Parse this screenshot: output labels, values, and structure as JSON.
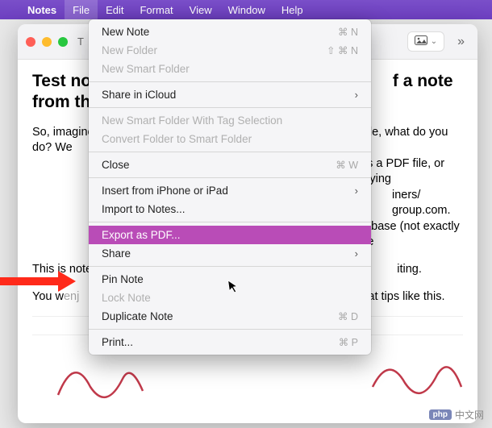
{
  "menubar": {
    "app": "Notes",
    "items": [
      "File",
      "Edit",
      "Format",
      "View",
      "Window",
      "Help"
    ]
  },
  "titlebar": {
    "title_fragment": "T",
    "media_icon": "image-icon"
  },
  "content": {
    "heading_left": "Test no",
    "heading_right": "f a note from th",
    "p1_left": "So, imagine",
    "p1_right_1": "ile, what do you do? We",
    "p1_right_2": "e as a PDF file, or copying",
    "p1_right_3": "iners/ group.com.",
    "p1_right_4": "atabase (not exactly use",
    "p2_left": "This is note",
    "p2_right": "iting.",
    "p3_left": "You w",
    "p3_mid": "enj",
    "p3_right": "at tips like this."
  },
  "dropdown": {
    "items": [
      {
        "label": "New Note",
        "shortcut": "⌘ N",
        "disabled": false
      },
      {
        "label": "New Folder",
        "shortcut": "⇧ ⌘ N",
        "disabled": true
      },
      {
        "label": "New Smart Folder",
        "disabled": true
      },
      {
        "sep": true
      },
      {
        "label": "Share in iCloud",
        "submenu": true
      },
      {
        "sep": true
      },
      {
        "label": "New Smart Folder With Tag Selection",
        "disabled": true
      },
      {
        "label": "Convert Folder to Smart Folder",
        "disabled": true
      },
      {
        "sep": true
      },
      {
        "label": "Close",
        "shortcut": "⌘ W"
      },
      {
        "sep": true
      },
      {
        "label": "Insert from iPhone or iPad",
        "submenu": true
      },
      {
        "label": "Import to Notes..."
      },
      {
        "sep": true
      },
      {
        "label": "Export as PDF...",
        "highlight": true
      },
      {
        "label": "Share",
        "submenu": true
      },
      {
        "sep": true
      },
      {
        "label": "Pin Note"
      },
      {
        "label": "Lock Note",
        "disabled": true
      },
      {
        "label": "Duplicate Note",
        "shortcut": "⌘ D"
      },
      {
        "sep": true
      },
      {
        "label": "Print...",
        "shortcut": "⌘ P"
      }
    ]
  },
  "watermark": {
    "text": "中文网"
  }
}
